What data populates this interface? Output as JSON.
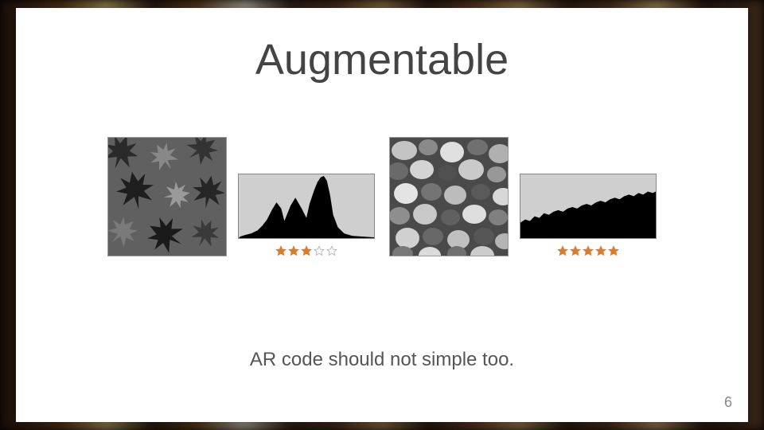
{
  "title": "Augmentable",
  "caption": "AR code should not simple too.",
  "page_number": "6",
  "items": [
    {
      "rating": 3,
      "max_rating": 5
    },
    {
      "rating": 5,
      "max_rating": 5
    }
  ],
  "star_color_filled": "#d97b2a",
  "star_color_empty": "#b0b0b0"
}
